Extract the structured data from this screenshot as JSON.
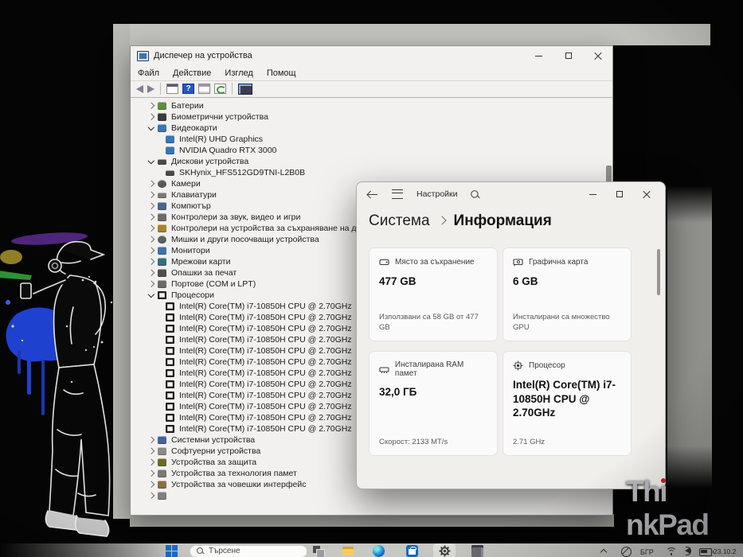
{
  "device_manager": {
    "window_title": "Диспечер на устройства",
    "menu_items": [
      "Файл",
      "Действие",
      "Изглед",
      "Помощ"
    ],
    "toolbar_icons": [
      "back",
      "forward",
      "console",
      "help",
      "properties",
      "scan-for-hardware-changes",
      "computer"
    ],
    "tree": [
      {
        "s": "col",
        "i": "battery",
        "l": "Батерии"
      },
      {
        "s": "col",
        "i": "biometric",
        "l": "Биометрични устройства"
      },
      {
        "s": "exp",
        "i": "display",
        "l": "Видеокарти"
      },
      {
        "s": "none",
        "i": "display",
        "l": "Intel(R) UHD Graphics",
        "lvl": 2
      },
      {
        "s": "none",
        "i": "display",
        "l": "NVIDIA Quadro RTX 3000",
        "lvl": 2
      },
      {
        "s": "exp",
        "i": "disk",
        "l": "Дискови устройства"
      },
      {
        "s": "none",
        "i": "disk",
        "l": "SKHynix_HFS512GD9TNI-L2B0B",
        "lvl": 2
      },
      {
        "s": "col",
        "i": "camera",
        "l": "Камери"
      },
      {
        "s": "col",
        "i": "keyboard",
        "l": "Клавиатури"
      },
      {
        "s": "col",
        "i": "computer",
        "l": "Компютър"
      },
      {
        "s": "col",
        "i": "audio",
        "l": "Контролери за звук, видео и игри"
      },
      {
        "s": "col",
        "i": "storage-controller",
        "l": "Контролери на устройства за съхраняване на данни"
      },
      {
        "s": "col",
        "i": "mouse",
        "l": "Мишки и други посочващи устройства"
      },
      {
        "s": "col",
        "i": "monitor",
        "l": "Монитори"
      },
      {
        "s": "col",
        "i": "network",
        "l": "Мрежови карти"
      },
      {
        "s": "col",
        "i": "printer",
        "l": "Опашки за печат"
      },
      {
        "s": "col",
        "i": "ports",
        "l": "Портове (COM и LPT)"
      },
      {
        "s": "exp",
        "i": "cpu",
        "l": "Процесори"
      },
      {
        "s": "none",
        "i": "cpu",
        "l": "Intel(R) Core(TM) i7-10850H CPU @ 2.70GHz",
        "lvl": 2
      },
      {
        "s": "none",
        "i": "cpu",
        "l": "Intel(R) Core(TM) i7-10850H CPU @ 2.70GHz",
        "lvl": 2
      },
      {
        "s": "none",
        "i": "cpu",
        "l": "Intel(R) Core(TM) i7-10850H CPU @ 2.70GHz",
        "lvl": 2
      },
      {
        "s": "none",
        "i": "cpu",
        "l": "Intel(R) Core(TM) i7-10850H CPU @ 2.70GHz",
        "lvl": 2
      },
      {
        "s": "none",
        "i": "cpu",
        "l": "Intel(R) Core(TM) i7-10850H CPU @ 2.70GHz",
        "lvl": 2
      },
      {
        "s": "none",
        "i": "cpu",
        "l": "Intel(R) Core(TM) i7-10850H CPU @ 2.70GHz",
        "lvl": 2
      },
      {
        "s": "none",
        "i": "cpu",
        "l": "Intel(R) Core(TM) i7-10850H CPU @ 2.70GHz",
        "lvl": 2
      },
      {
        "s": "none",
        "i": "cpu",
        "l": "Intel(R) Core(TM) i7-10850H CPU @ 2.70GHz",
        "lvl": 2
      },
      {
        "s": "none",
        "i": "cpu",
        "l": "Intel(R) Core(TM) i7-10850H CPU @ 2.70GHz",
        "lvl": 2
      },
      {
        "s": "none",
        "i": "cpu",
        "l": "Intel(R) Core(TM) i7-10850H CPU @ 2.70GHz",
        "lvl": 2
      },
      {
        "s": "none",
        "i": "cpu",
        "l": "Intel(R) Core(TM) i7-10850H CPU @ 2.70GHz",
        "lvl": 2
      },
      {
        "s": "none",
        "i": "cpu",
        "l": "Intel(R) Core(TM) i7-10850H CPU @ 2.70GHz",
        "lvl": 2
      },
      {
        "s": "col",
        "i": "system",
        "l": "Системни устройства"
      },
      {
        "s": "col",
        "i": "software",
        "l": "Софтуерни устройства"
      },
      {
        "s": "col",
        "i": "security",
        "l": "Устройства за защита"
      },
      {
        "s": "col",
        "i": "memory",
        "l": "Устройства за технология памет"
      },
      {
        "s": "col",
        "i": "hid",
        "l": "Устройства за човешки интерфейс"
      },
      {
        "s": "col",
        "i": "generic",
        "l": ""
      }
    ]
  },
  "settings": {
    "app_label": "Настройки",
    "breadcrumb_parent": "Система",
    "breadcrumb_current": "Информация",
    "cards": [
      {
        "icon": "storage-icon",
        "label": "Място за съхранение",
        "value": "477 GB",
        "subtitle": "Използвани са 58 GB от 477 GB"
      },
      {
        "icon": "gpu-icon",
        "label": "Графична карта",
        "value": "6 GB",
        "subtitle": "Инсталирани са множество GPU"
      },
      {
        "icon": "ram-icon",
        "label": "Инсталирана RAM памет",
        "value": "32,0 ГБ",
        "subtitle": "Скорост: 2133 MT/s"
      },
      {
        "icon": "cpu-icon",
        "label": "Процесор",
        "value": "Intel(R) Core(TM) i7-10850H CPU @ 2.70GHz",
        "subtitle": "2.71 GHz"
      }
    ]
  },
  "taskbar": {
    "search_label": "Търсене",
    "tray_language": "БГР",
    "tray_clock_partial": "23.10.2",
    "pinned_icons": [
      "start",
      "search",
      "task-view",
      "file-explorer",
      "edge",
      "store",
      "settings",
      "device-manager"
    ],
    "tray_icons": [
      "chevron-up",
      "notifications-off",
      "language",
      "wifi",
      "volume",
      "battery"
    ]
  },
  "branding": {
    "device_logo": "ThinkPad"
  },
  "colors": {
    "accent_blue": "#0f6cbd",
    "start_blue": "#1270cf",
    "settings_window_bg": "#f1efec",
    "card_bg": "#fbfafa",
    "device_manager_bg": "#f2f1ef",
    "taskbar_bg": "#c7c7c4",
    "thinkpad_red": "#c22127",
    "splash_blue": "#1f41cf",
    "splash_green": "#2f8f35",
    "splash_purple": "#5b2d91",
    "splash_yellow": "#a08c28"
  }
}
